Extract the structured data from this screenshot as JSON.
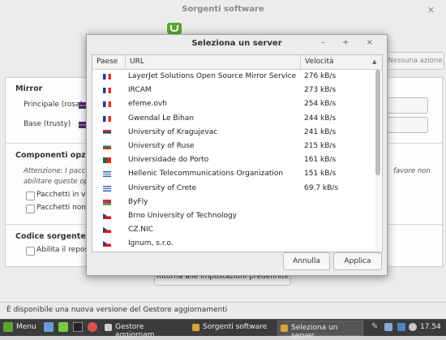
{
  "background_window": {
    "title": "Sorgenti software",
    "no_actions_label": "Nessuna azione",
    "mirror_section_title": "Mirror",
    "principale_label": "Principale (rosa)",
    "base_label": "Base (trusty)",
    "components_title": "Componenti opzionali",
    "attention_text_left": "Attenzione: I pacchetti",
    "attention_text_left2": "abilitare queste opzio",
    "attention_text_right": "favore non",
    "pkg_option_1": "Pacchetti in versione",
    "pkg_option_2": "Pacchetti non st",
    "source_code_title": "Codice sorgente",
    "enable_repo_label": "Abilita il reposito",
    "restore_button_label": "Ritorna alle impostazioni predefinite",
    "status_text": "È disponibile una nuova versione del Gestore aggiornamenti"
  },
  "dialog": {
    "title": "Seleziona un server",
    "columns": [
      "Paese",
      "URL",
      "Velocità"
    ],
    "sort_indicator": "▲",
    "rows": [
      {
        "flag": "france",
        "url": "LayerJet Solutions Open Source Mirror Service",
        "speed": "276 kB/s"
      },
      {
        "flag": "france",
        "url": "IRCAM",
        "speed": "273 kB/s"
      },
      {
        "flag": "france",
        "url": "efeme.ovh",
        "speed": "254 kB/s"
      },
      {
        "flag": "france",
        "url": "Gwendal Le Bihan",
        "speed": "244 kB/s"
      },
      {
        "flag": "serbia",
        "url": "University of Kragujevac",
        "speed": "241 kB/s"
      },
      {
        "flag": "bulgaria",
        "url": "University of Ruse",
        "speed": "215 kB/s"
      },
      {
        "flag": "portugal",
        "url": "Universidade do Porto",
        "speed": "161 kB/s"
      },
      {
        "flag": "greece",
        "url": "Hellenic Telecommunications Organization",
        "speed": "151 kB/s"
      },
      {
        "flag": "greece",
        "url": "University of Crete",
        "speed": "69.7 kB/s"
      },
      {
        "flag": "belarus",
        "url": "ByFly",
        "speed": ""
      },
      {
        "flag": "czech",
        "url": "Brno University of Technology",
        "speed": ""
      },
      {
        "flag": "czech",
        "url": "CZ.NIC",
        "speed": ""
      },
      {
        "flag": "czech",
        "url": "Ignum, s.r.o.",
        "speed": ""
      }
    ],
    "cancel_label": "Annulla",
    "apply_label": "Applica",
    "window_controls": "– + ×"
  },
  "taskbar": {
    "menu_label": "Menu",
    "items": [
      "Gestore aggiornam...",
      "Sorgenti software",
      "Seleziona un server"
    ],
    "clock": "17.54"
  }
}
